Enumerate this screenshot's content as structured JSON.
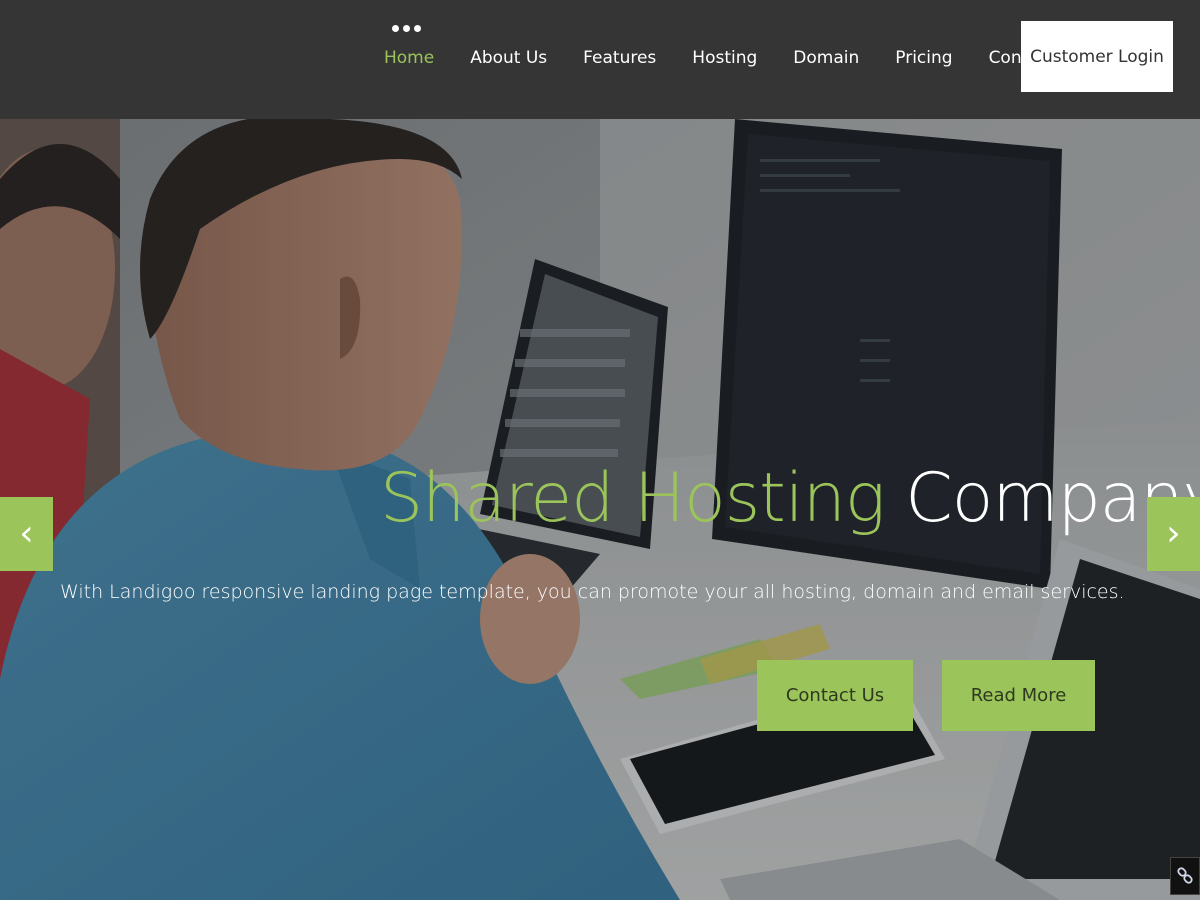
{
  "header": {
    "menu_dots": "menu-dots-icon",
    "nav": [
      {
        "label": "Home",
        "active": true
      },
      {
        "label": "About Us"
      },
      {
        "label": "Features"
      },
      {
        "label": "Hosting"
      },
      {
        "label": "Domain"
      },
      {
        "label": "Pricing"
      },
      {
        "label": "Contact"
      }
    ],
    "login_label": "Customer Login"
  },
  "hero": {
    "headline_accent": "Shared Hosting",
    "headline_rest": "Company",
    "subtitle": "With Landigoo responsive landing page template, you can promote your all hosting, domain and email services.",
    "contact_label": "Contact Us",
    "read_more_label": "Read More",
    "prev_icon": "‹",
    "next_icon": "›"
  },
  "colors": {
    "accent": "#9bc45a",
    "header_bg": "#353535",
    "white": "#ffffff"
  },
  "icons": {
    "prev": "chevron-left-icon",
    "next": "chevron-right-icon",
    "corner": "link-icon"
  }
}
